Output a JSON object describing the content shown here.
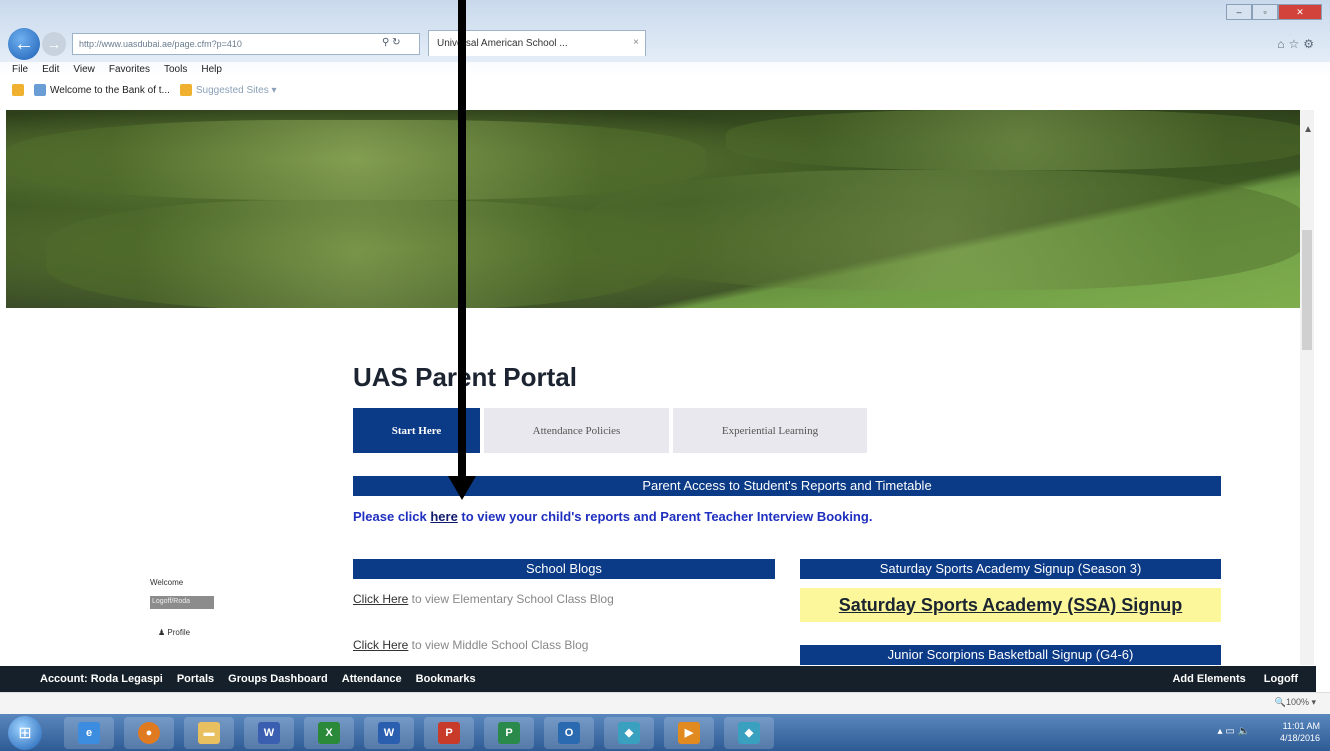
{
  "browser": {
    "address": "http://www.uasdubai.ae/page.cfm?p=410",
    "tab_title": "Universal American School ...",
    "menu": [
      "File",
      "Edit",
      "View",
      "Favorites",
      "Tools",
      "Help"
    ],
    "favorites": [
      {
        "label": "Welcome to the Bank of t..."
      },
      {
        "label": "Suggested Sites ▾"
      }
    ],
    "zoom": "🔍100% ▾"
  },
  "page": {
    "title": "UAS Parent Portal",
    "tabs": [
      {
        "label": "Start Here",
        "active": true
      },
      {
        "label": "Attendance Policies",
        "active": false
      },
      {
        "label": "Experiential Learning",
        "active": false
      }
    ],
    "access_header": "Parent Access to Student's Reports and Timetable",
    "access_text_pre": "Please click ",
    "access_link": "here",
    "access_text_post": " to view your child's reports and Parent Teacher Interview Booking.",
    "blogs_header": "School Blogs",
    "blog_lines": [
      {
        "link": "Click Here",
        "text": " to view Elementary School Class Blog"
      },
      {
        "link": "Click Here",
        "text": " to view Middle School Class Blog"
      }
    ],
    "ssa_header": "Saturday Sports Academy Signup (Season 3)",
    "ssa_button": "Saturday Sports Academy (SSA) Signup",
    "jsb_header": "Junior Scorpions Basketball Signup (G4-6)"
  },
  "sidebar": {
    "welcome": "Welcome",
    "name": "Logoff/Roda",
    "profile": "Profile"
  },
  "footer_nav": {
    "left": [
      "Account: Roda Legaspi",
      "Portals",
      "Groups Dashboard",
      "Attendance",
      "Bookmarks"
    ],
    "right": [
      "Add Elements",
      "Logoff"
    ]
  },
  "taskbar": {
    "time": "11:01 AM",
    "date": "4/18/2016",
    "apps": [
      "ie-icon",
      "firefox-icon",
      "folder-icon",
      "word-icon",
      "excel-icon",
      "word-icon",
      "powerpoint-icon",
      "project-icon",
      "outlook-icon",
      "app-icon",
      "media-icon",
      "app-icon"
    ]
  }
}
